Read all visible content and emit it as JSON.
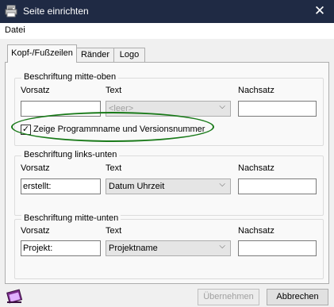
{
  "window": {
    "title": "Seite einrichten",
    "close_glyph": "✕",
    "icon": "printer-page-icon"
  },
  "menu": {
    "items": [
      "Datei"
    ]
  },
  "tabs": [
    {
      "label": "Kopf-/Fußzeilen",
      "active": true
    },
    {
      "label": "Ränder",
      "active": false
    },
    {
      "label": "Logo",
      "active": false
    }
  ],
  "groups": [
    {
      "title": "Beschriftung mitte-oben",
      "col_vorsatz": "Vorsatz",
      "col_text": "Text",
      "col_nachsatz": "Nachsatz",
      "vorsatz_value": "",
      "text_value": "<leer>",
      "text_disabled": true,
      "nachsatz_value": "",
      "checkbox": {
        "label": "Zeige Programmname und Versionsnummer",
        "checked": true,
        "mark": "✓"
      }
    },
    {
      "title": "Beschriftung links-unten",
      "col_vorsatz": "Vorsatz",
      "col_text": "Text",
      "col_nachsatz": "Nachsatz",
      "vorsatz_value": "erstellt:",
      "text_value": "Datum Uhrzeit",
      "nachsatz_value": ""
    },
    {
      "title": "Beschriftung mitte-unten",
      "col_vorsatz": "Vorsatz",
      "col_text": "Text",
      "col_nachsatz": "Nachsatz",
      "vorsatz_value": "Projekt:",
      "text_value": "Projektname",
      "nachsatz_value": ""
    }
  ],
  "buttons": {
    "apply": "Übernehmen",
    "apply_disabled": true,
    "cancel": "Abbrechen"
  },
  "colors": {
    "titlebar": "#1f2a44",
    "highlight_oval": "#1a7a1a"
  }
}
